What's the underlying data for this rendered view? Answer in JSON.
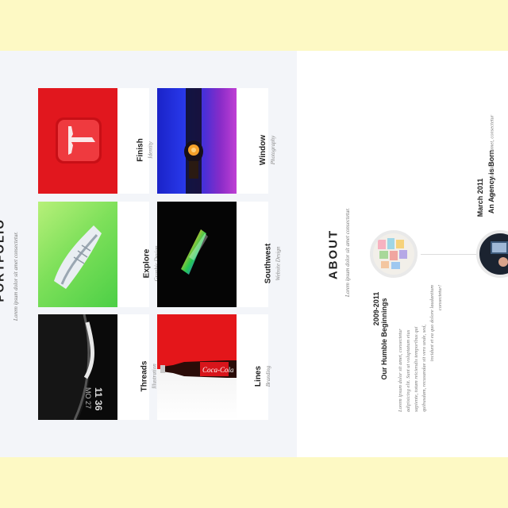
{
  "portfolio": {
    "title": "PORTFOLIO",
    "subtitle": "Lorem ipsum dolor sit amet consectetur.",
    "items": [
      {
        "title": "Finish",
        "category": "Identity",
        "thumb": "tesla-logo"
      },
      {
        "title": "Window",
        "category": "Photography",
        "thumb": "perfume-bottle"
      },
      {
        "title": "Explore",
        "category": "Graphic Design",
        "thumb": "sneaker"
      },
      {
        "title": "Southwest",
        "category": "Website Design",
        "thumb": "prism"
      },
      {
        "title": "Threads",
        "category": "Illustration",
        "thumb": "watch"
      },
      {
        "title": "Lines",
        "category": "Branding",
        "thumb": "coca-cola-bottle"
      }
    ]
  },
  "about": {
    "title": "ABOUT",
    "subtitle": "Lorem ipsum dolor sit amet consectetur.",
    "timeline": [
      {
        "date": "2009-2011",
        "heading": "Our Humble Beginnings",
        "body": [
          "Lorem ipsum dolor sit amet, consectetur",
          "adipisicing elit. Sunt ut voluptatum eius",
          "sapiente, totam reiciendis temporibus qui",
          "quibusdam, recusandae sit vero unde, sed,",
          "incidunt et ea quo dolore laudantium",
          "consectetur!"
        ]
      },
      {
        "date": "March 2011",
        "heading": "An Agency is Born",
        "body": [
          "Lorem ipsum dolor sit amet, consectetur"
        ]
      }
    ]
  },
  "colors": {
    "page_band": "#fdf9c4",
    "portfolio_bg": "#f3f5f9",
    "tesla_red": "#e1171e",
    "coke_red": "#e4161a",
    "green": "#6ed452"
  }
}
